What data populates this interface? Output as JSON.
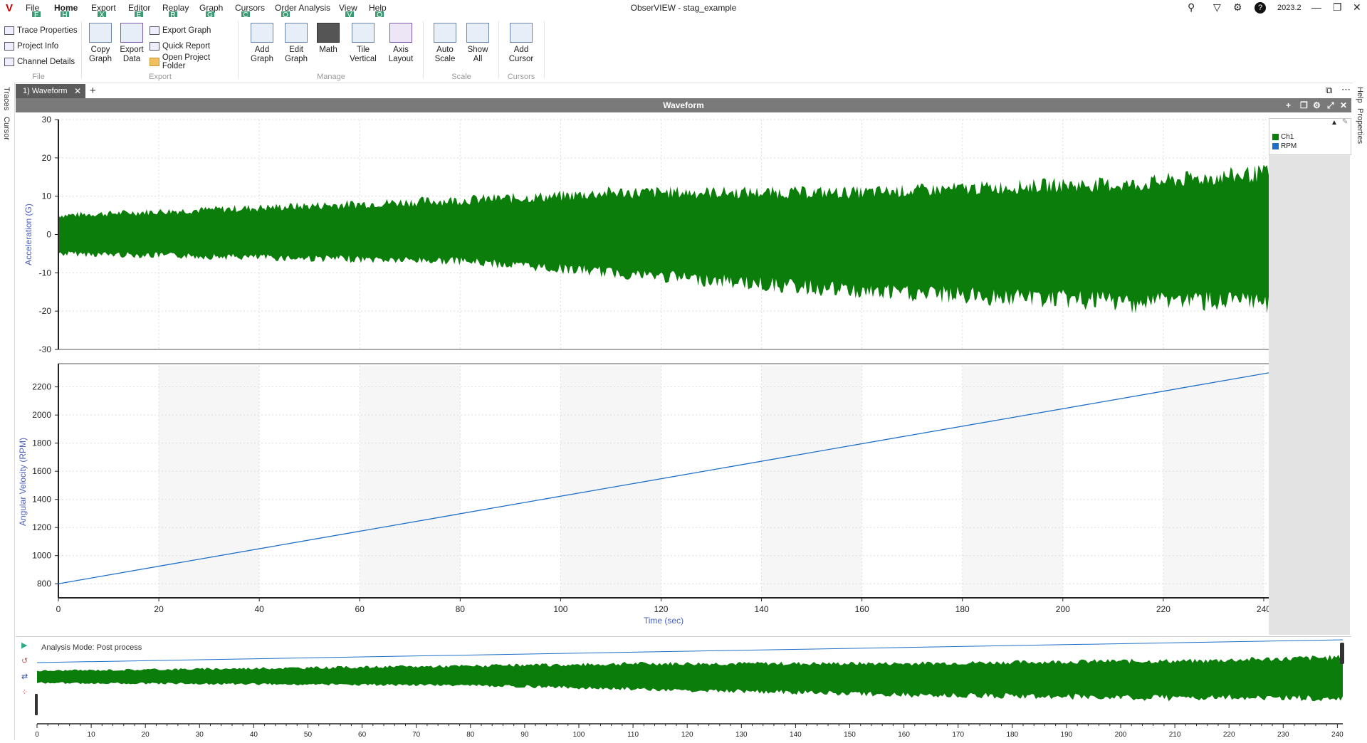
{
  "app": {
    "title": "ObserVIEW - stag_example",
    "version": "2023.2"
  },
  "menu": [
    {
      "label": "File",
      "keytip": "F"
    },
    {
      "label": "Home",
      "keytip": "H",
      "active": true
    },
    {
      "label": "Export",
      "keytip": "X"
    },
    {
      "label": "Editor",
      "keytip": "E"
    },
    {
      "label": "Replay",
      "keytip": "R"
    },
    {
      "label": "Graph",
      "keytip": "G"
    },
    {
      "label": "Cursors",
      "keytip": "C"
    },
    {
      "label": "Order Analysis",
      "keytip": "O"
    },
    {
      "label": "View",
      "keytip": "V"
    },
    {
      "label": "Help",
      "keytip": "Q"
    }
  ],
  "ribbon": {
    "file_items": [
      "Trace Properties",
      "Project Info",
      "Channel Details"
    ],
    "file_label": "File",
    "copy_graph": "Copy Graph",
    "export_data": "Export Data",
    "export_items": [
      "Export Graph",
      "Quick Report",
      "Open Project Folder"
    ],
    "export_label": "Export",
    "add_graph": "Add Graph",
    "edit_graph": "Edit Graph",
    "math": "Math",
    "tile_vertical": "Tile Vertical",
    "axis_layout": "Axis Layout",
    "manage_label": "Manage",
    "auto_scale": "Auto Scale",
    "show_all": "Show All",
    "scale_label": "Scale",
    "add_cursor": "Add Cursor",
    "cursors_label": "Cursors"
  },
  "side": {
    "left_tabs": [
      "Traces",
      "Cursor"
    ],
    "right_tabs": [
      "Help",
      "Properties"
    ]
  },
  "document_tab": "1) Waveform",
  "panel_title": "Waveform",
  "legend": [
    {
      "name": "Ch1",
      "color": "#0a7d0a"
    },
    {
      "name": "RPM",
      "color": "#1e6fc8"
    }
  ],
  "overview": {
    "mode": "Analysis Mode: Post process"
  },
  "chart_data": [
    {
      "type": "area",
      "title": "",
      "xlabel": "",
      "ylabel": "Acceleration (G)",
      "xlim": [
        0,
        241
      ],
      "ylim": [
        -30,
        30
      ],
      "yticks": [
        -30,
        -20,
        -10,
        0,
        10,
        20,
        30
      ],
      "series": [
        {
          "name": "Ch1",
          "color": "#0a7d0a",
          "x": [
            0,
            20,
            40,
            60,
            80,
            100,
            110,
            120,
            140,
            160,
            180,
            200,
            215,
            220,
            240
          ],
          "upper": [
            5,
            6,
            7,
            8,
            9,
            10,
            11,
            11,
            11,
            11,
            12,
            13,
            13,
            14,
            16
          ],
          "lower": [
            -5,
            -5.5,
            -6,
            -6.5,
            -7,
            -9,
            -10,
            -11,
            -13,
            -15,
            -16,
            -17,
            -18,
            -17,
            -18
          ]
        }
      ]
    },
    {
      "type": "line",
      "title": "",
      "xlabel": "Time (sec)",
      "ylabel": "Angular Velocity (RPM)",
      "xlim": [
        0,
        241
      ],
      "ylim": [
        700,
        2350
      ],
      "yticks": [
        800,
        1000,
        1200,
        1400,
        1600,
        1800,
        2000,
        2200
      ],
      "xticks": [
        0,
        20,
        40,
        60,
        80,
        100,
        120,
        140,
        160,
        180,
        200,
        220,
        240
      ],
      "grid": true,
      "series": [
        {
          "name": "RPM",
          "color": "#1e6fc8",
          "x": [
            0,
            241
          ],
          "values": [
            800,
            2300
          ]
        }
      ]
    }
  ],
  "overview_ticks": [
    0,
    10,
    20,
    30,
    40,
    50,
    60,
    70,
    80,
    90,
    100,
    110,
    120,
    130,
    140,
    150,
    160,
    170,
    180,
    190,
    200,
    210,
    220,
    230,
    240
  ]
}
